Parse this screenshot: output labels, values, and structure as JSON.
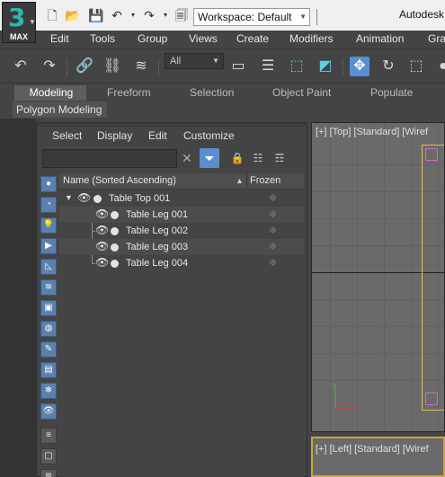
{
  "app": {
    "logo_number": "3",
    "logo_label": "MAX",
    "title": "Autodesk",
    "workspace": "Workspace: Default"
  },
  "menu": [
    "Edit",
    "Tools",
    "Group",
    "Views",
    "Create",
    "Modifiers",
    "Animation",
    "Gra"
  ],
  "toolbar": {
    "selection_filter": "All"
  },
  "ribbon": {
    "tabs": [
      "Modeling",
      "Freeform",
      "Selection",
      "Object Paint",
      "Populate"
    ],
    "active_tab": "Modeling",
    "panel": "Polygon Modeling"
  },
  "explorer": {
    "menu": [
      "Select",
      "Display",
      "Edit",
      "Customize"
    ],
    "search_value": "",
    "columns": {
      "name": "Name (Sorted Ascending)",
      "frozen": "Frozen"
    },
    "rows": [
      {
        "label": "Table Top 001",
        "level": 0,
        "frozen": "❄"
      },
      {
        "label": "Table Leg 001",
        "level": 1,
        "frozen": "❄"
      },
      {
        "label": "Table Leg 002",
        "level": 1,
        "frozen": "❄"
      },
      {
        "label": "Table Leg 003",
        "level": 1,
        "frozen": "❄"
      },
      {
        "label": "Table Leg 004",
        "level": 1,
        "frozen": "❄"
      }
    ]
  },
  "viewports": {
    "top_label": "[+] [Top] [Standard] [Wiref",
    "left_label": "[+] [Left] [Standard] [Wiref"
  },
  "icons": {
    "undo": "undo-icon",
    "redo": "redo-icon",
    "link": "link-icon",
    "unlink": "unlink-icon",
    "bind": "bind-space-warp-icon",
    "select": "select-object-icon",
    "move": "move-icon",
    "rotate": "rotate-icon",
    "scale": "scale-icon"
  },
  "colors": {
    "accent_blue": "#5a8fcf",
    "logo_teal": "#2ab6b6",
    "selection_outline": "#e3c24a",
    "pink_marker": "#d26ac8"
  }
}
